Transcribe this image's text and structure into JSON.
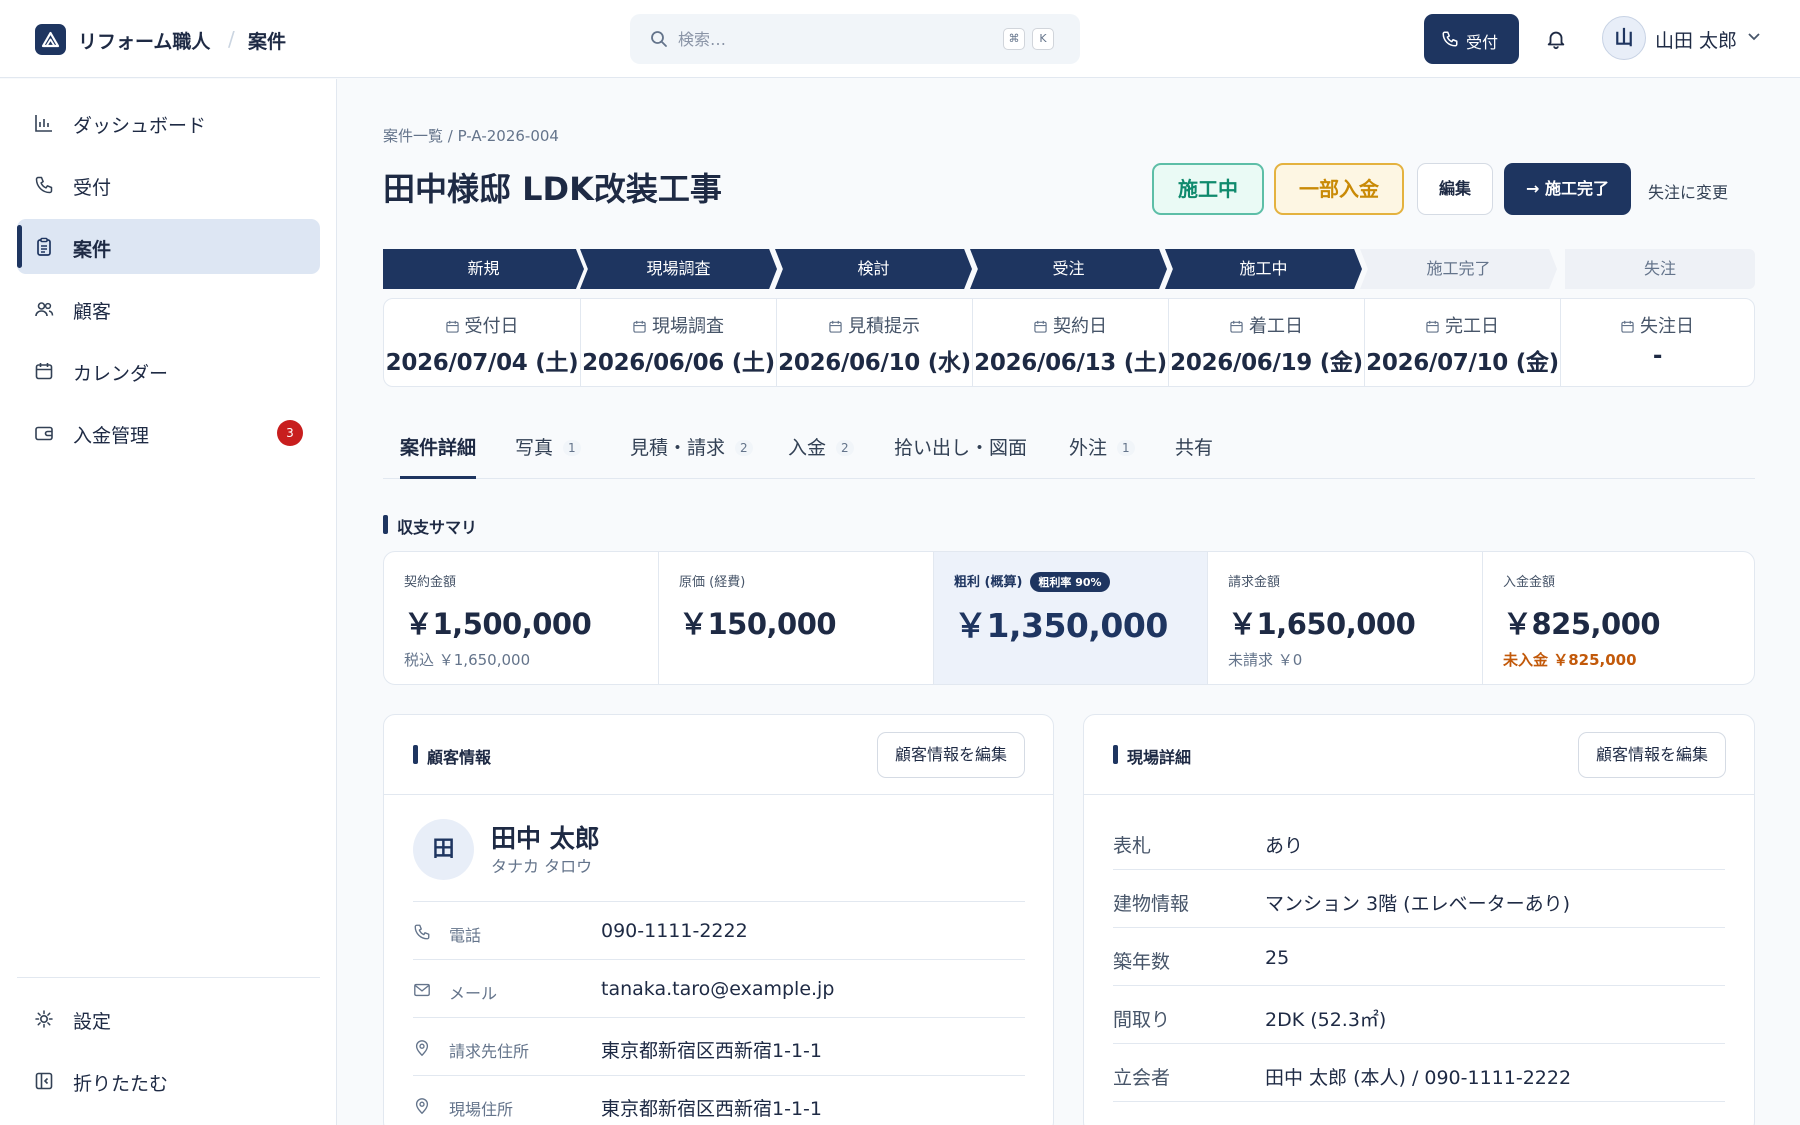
{
  "header": {
    "app_name": "リフォーム職人",
    "section": "案件",
    "search_placeholder": "検索…",
    "shortcut_keys": [
      "⌘",
      "K"
    ],
    "reception_label": "受付",
    "user_initial": "山",
    "user_name": "山田 太郎"
  },
  "sidebar": {
    "items": [
      {
        "label": "ダッシュボード",
        "icon": "bar-chart-icon"
      },
      {
        "label": "受付",
        "icon": "phone-icon"
      },
      {
        "label": "案件",
        "icon": "clipboard-icon",
        "active": true
      },
      {
        "label": "顧客",
        "icon": "users-icon"
      },
      {
        "label": "カレンダー",
        "icon": "calendar-icon"
      },
      {
        "label": "入金管理",
        "icon": "wallet-icon",
        "badge": "3"
      }
    ],
    "settings_label": "設定",
    "collapse_label": "折りたたむ"
  },
  "project": {
    "breadcrumb": "案件一覧  /  P-A-2026-004",
    "title": "田中様邸 LDK改装工事",
    "status": "施工中",
    "payment_status": "一部入金",
    "edit_label": "編集",
    "complete_label": "→ 施工完了",
    "lost_label": "失注に変更"
  },
  "stages": [
    {
      "label": "新規",
      "done": true
    },
    {
      "label": "現場調査",
      "done": true
    },
    {
      "label": "検討",
      "done": true
    },
    {
      "label": "受注",
      "done": true
    },
    {
      "label": "施工中",
      "done": true
    },
    {
      "label": "施工完了",
      "done": false
    },
    {
      "label": "失注",
      "done": false
    }
  ],
  "dates": [
    {
      "label": "受付日",
      "value": "2026/07/04 (土)"
    },
    {
      "label": "現場調査",
      "value": "2026/06/06 (土)"
    },
    {
      "label": "見積提示",
      "value": "2026/06/10 (水)"
    },
    {
      "label": "契約日",
      "value": "2026/06/13 (土)"
    },
    {
      "label": "着工日",
      "value": "2026/06/19 (金)"
    },
    {
      "label": "完工日",
      "value": "2026/07/10 (金)"
    },
    {
      "label": "失注日",
      "value": "-"
    }
  ],
  "tabs": [
    {
      "label": "案件詳細",
      "count": "",
      "active": true
    },
    {
      "label": "写真",
      "count": "1"
    },
    {
      "label": "見積・請求",
      "count": "2"
    },
    {
      "label": "入金",
      "count": "2"
    },
    {
      "label": "拾い出し・図面",
      "count": ""
    },
    {
      "label": "外注",
      "count": "1"
    },
    {
      "label": "共有",
      "count": ""
    }
  ],
  "summary": {
    "title": "収支サマリ",
    "cards": [
      {
        "label": "契約金額",
        "value": "￥1,500,000",
        "sub": "税込 ￥1,650,000"
      },
      {
        "label": "原価 (経費)",
        "value": "￥150,000",
        "sub": ""
      },
      {
        "label": "粗利 (概算)",
        "badge": "粗利率 90%",
        "value": "￥1,350,000",
        "sub": ""
      },
      {
        "label": "請求金額",
        "value": "￥1,650,000",
        "sub": "未請求 ￥0"
      },
      {
        "label": "入金金額",
        "value": "￥825,000",
        "sub": "未入金 ￥825,000"
      }
    ]
  },
  "customer": {
    "panel_title": "顧客情報",
    "edit_label": "顧客情報を編集",
    "initial": "田",
    "name": "田中 太郎",
    "kana": "タナカ タロウ",
    "rows": [
      {
        "label": "電話",
        "value": "090-1111-2222",
        "icon": "phone-icon"
      },
      {
        "label": "メール",
        "value": "tanaka.taro@example.jp",
        "icon": "mail-icon"
      },
      {
        "label": "請求先住所",
        "value": "東京都新宿区西新宿1-1-1",
        "icon": "map-pin-icon"
      },
      {
        "label": "現場住所",
        "value": "東京都新宿区西新宿1-1-1",
        "icon": "map-pin-icon"
      }
    ]
  },
  "site": {
    "panel_title": "現場詳細",
    "edit_label": "顧客情報を編集",
    "rows": [
      {
        "label": "表札",
        "value": "あり"
      },
      {
        "label": "建物情報",
        "value": "マンション 3階 (エレベーターあり)"
      },
      {
        "label": "築年数",
        "value": "25"
      },
      {
        "label": "間取り",
        "value": "2DK (52.3㎡)"
      },
      {
        "label": "立会者",
        "value": "田中 太郎 (本人) / 090-1111-2222"
      }
    ]
  },
  "colors": {
    "primary": "#1e3560",
    "success": "#0f8a6d",
    "warning": "#c98a06",
    "danger": "#c81e1e"
  }
}
